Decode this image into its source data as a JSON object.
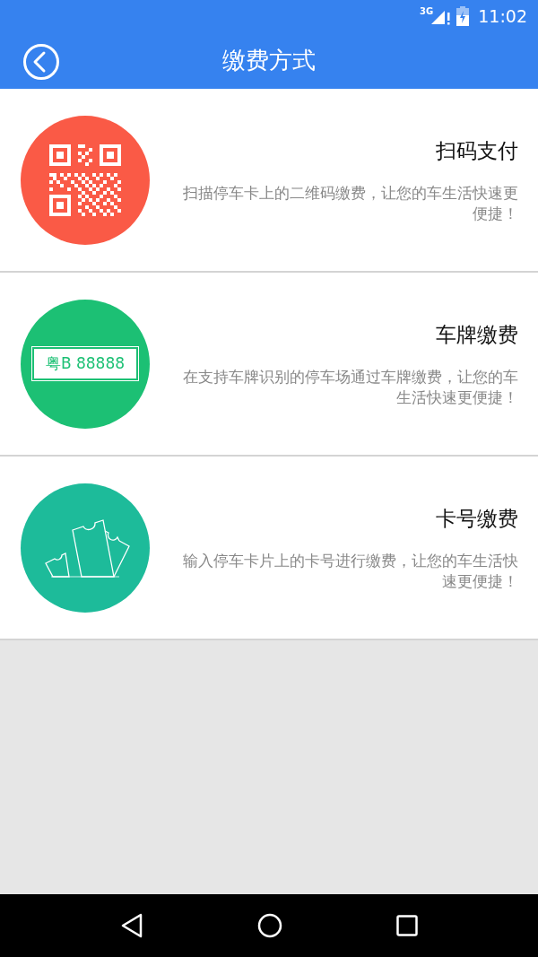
{
  "status_bar": {
    "network": "3G",
    "time": "11:02"
  },
  "app_bar": {
    "title": "缴费方式"
  },
  "methods": [
    {
      "kind": "qr",
      "color": "#fa5a46",
      "title": "扫码支付",
      "description": "扫描停车卡上的二维码缴费，让您的车生活快速更便捷！"
    },
    {
      "kind": "plate",
      "color": "#1cc074",
      "plate_text": "粤B 88888",
      "title": "车牌缴费",
      "description": "在支持车牌识别的停车场通过车牌缴费，让您的车生活快速更便捷！"
    },
    {
      "kind": "tickets",
      "color": "#1dbb9a",
      "title": "卡号缴费",
      "description": "输入停车卡片上的卡号进行缴费，让您的车生活快速更便捷！"
    }
  ]
}
